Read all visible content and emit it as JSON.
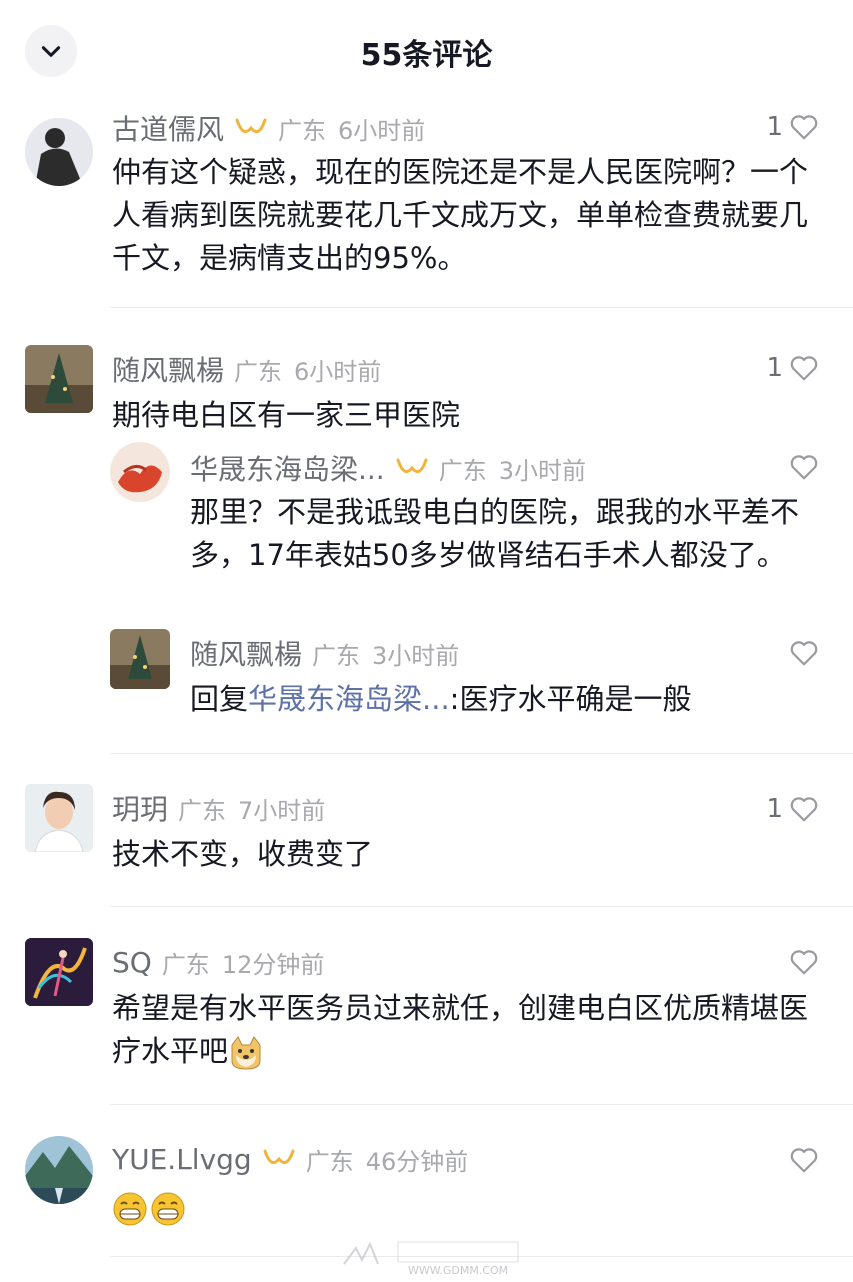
{
  "header": {
    "title": "55条评论",
    "back_icon": "chevron-down-icon"
  },
  "comments": [
    {
      "user": "古道儒风",
      "location": "广东",
      "time": "6小时前",
      "likes": "1",
      "text": "仲有这个疑惑，现在的医院还是不是人民医院啊？一个人看病到医院就要花几千文成万文，单单检查费就要几千文，是病情支出的95%。"
    },
    {
      "user": "随风飘楊",
      "location": "广东",
      "time": "6小时前",
      "likes": "1",
      "text": "期待电白区有一家三甲医院",
      "replies": [
        {
          "user": "华晟东海岛梁...",
          "location": "广东",
          "time": "3小时前",
          "likes": "",
          "text": "那里？不是我诋毁电白的医院，跟我的水平差不多，17年表姑50多岁做肾结石手术人都没了。"
        },
        {
          "user": "随风飘楊",
          "location": "广东",
          "time": "3小时前",
          "likes": "",
          "reply_prefix": "回复",
          "mention": "华晟东海岛梁...",
          "text": ":医疗水平确是一般"
        }
      ]
    },
    {
      "user": "玥玥",
      "location": "广东",
      "time": "7小时前",
      "likes": "1",
      "text": "技术不变，收费变了"
    },
    {
      "user": "SQ",
      "location": "广东",
      "time": "12分钟前",
      "likes": "",
      "text": "希望是有水平医务员过来就任，创建电白区优质精堪医疗水平吧"
    },
    {
      "user": "YUE.Llvgg",
      "location": "广东",
      "time": "46分钟前",
      "likes": "",
      "text": ""
    }
  ],
  "watermark": {
    "site": "WWW.GDMM.COM"
  },
  "colors": {
    "username": "#6b6d75",
    "meta": "#a8a9ad",
    "text": "#161823",
    "mention": "#5c72a8",
    "badge": "#f0b43c"
  }
}
